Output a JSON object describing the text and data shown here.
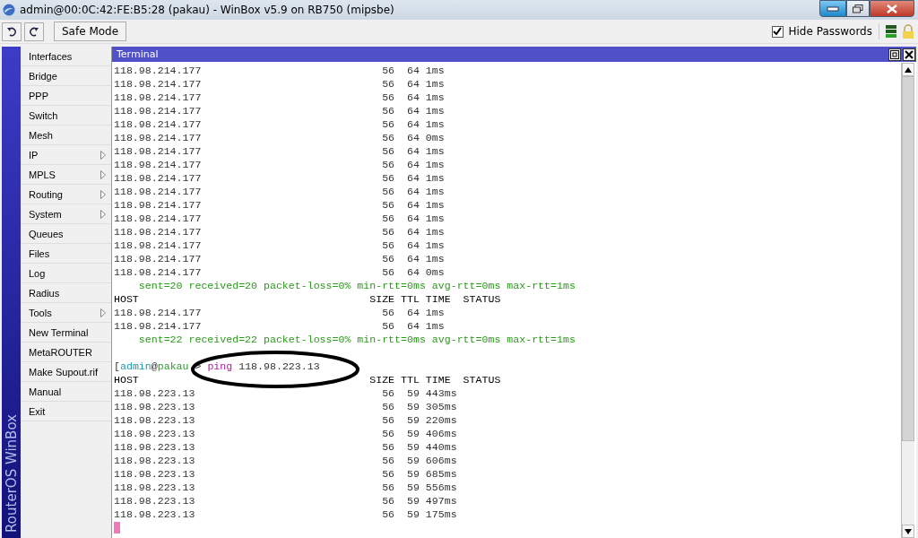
{
  "window": {
    "title": "admin@00:0C:42:FE:B5:28 (pakau) - WinBox v5.9 on RB750 (mipsbe)"
  },
  "toolbar": {
    "safe_mode": "Safe Mode",
    "hide_passwords": {
      "label": "Hide Passwords",
      "checked": true
    }
  },
  "sidebar": {
    "brand": "RouterOS WinBox",
    "items": [
      {
        "label": "Interfaces",
        "submenu": false
      },
      {
        "label": "Bridge",
        "submenu": false
      },
      {
        "label": "PPP",
        "submenu": false
      },
      {
        "label": "Switch",
        "submenu": false
      },
      {
        "label": "Mesh",
        "submenu": false
      },
      {
        "label": "IP",
        "submenu": true
      },
      {
        "label": "MPLS",
        "submenu": true
      },
      {
        "label": "Routing",
        "submenu": true
      },
      {
        "label": "System",
        "submenu": true
      },
      {
        "label": "Queues",
        "submenu": false
      },
      {
        "label": "Files",
        "submenu": false
      },
      {
        "label": "Log",
        "submenu": false
      },
      {
        "label": "Radius",
        "submenu": false
      },
      {
        "label": "Tools",
        "submenu": true
      },
      {
        "label": "New Terminal",
        "submenu": false
      },
      {
        "label": "MetaROUTER",
        "submenu": false
      },
      {
        "label": "Make Supout.rif",
        "submenu": false
      },
      {
        "label": "Manual",
        "submenu": false
      },
      {
        "label": "Exit",
        "submenu": false
      }
    ]
  },
  "terminal": {
    "title": "Terminal",
    "lines": [
      {
        "kind": "row",
        "host": "118.98.214.177",
        "size": "56",
        "ttl": "64",
        "time": "1ms"
      },
      {
        "kind": "row",
        "host": "118.98.214.177",
        "size": "56",
        "ttl": "64",
        "time": "1ms"
      },
      {
        "kind": "row",
        "host": "118.98.214.177",
        "size": "56",
        "ttl": "64",
        "time": "1ms"
      },
      {
        "kind": "row",
        "host": "118.98.214.177",
        "size": "56",
        "ttl": "64",
        "time": "1ms"
      },
      {
        "kind": "row",
        "host": "118.98.214.177",
        "size": "56",
        "ttl": "64",
        "time": "1ms"
      },
      {
        "kind": "row",
        "host": "118.98.214.177",
        "size": "56",
        "ttl": "64",
        "time": "0ms"
      },
      {
        "kind": "row",
        "host": "118.98.214.177",
        "size": "56",
        "ttl": "64",
        "time": "1ms"
      },
      {
        "kind": "row",
        "host": "118.98.214.177",
        "size": "56",
        "ttl": "64",
        "time": "1ms"
      },
      {
        "kind": "row",
        "host": "118.98.214.177",
        "size": "56",
        "ttl": "64",
        "time": "1ms"
      },
      {
        "kind": "row",
        "host": "118.98.214.177",
        "size": "56",
        "ttl": "64",
        "time": "1ms"
      },
      {
        "kind": "row",
        "host": "118.98.214.177",
        "size": "56",
        "ttl": "64",
        "time": "1ms"
      },
      {
        "kind": "row",
        "host": "118.98.214.177",
        "size": "56",
        "ttl": "64",
        "time": "1ms"
      },
      {
        "kind": "row",
        "host": "118.98.214.177",
        "size": "56",
        "ttl": "64",
        "time": "1ms"
      },
      {
        "kind": "row",
        "host": "118.98.214.177",
        "size": "56",
        "ttl": "64",
        "time": "1ms"
      },
      {
        "kind": "row",
        "host": "118.98.214.177",
        "size": "56",
        "ttl": "64",
        "time": "1ms"
      },
      {
        "kind": "row",
        "host": "118.98.214.177",
        "size": "56",
        "ttl": "64",
        "time": "0ms"
      },
      {
        "kind": "summary",
        "text": "sent=20 received=20 packet-loss=0% min-rtt=0ms avg-rtt=0ms max-rtt=1ms"
      },
      {
        "kind": "header",
        "host": "HOST",
        "size": "SIZE",
        "ttl": "TTL",
        "time": "TIME",
        "status": "STATUS"
      },
      {
        "kind": "row",
        "host": "118.98.214.177",
        "size": "56",
        "ttl": "64",
        "time": "1ms"
      },
      {
        "kind": "row",
        "host": "118.98.214.177",
        "size": "56",
        "ttl": "64",
        "time": "1ms"
      },
      {
        "kind": "summary",
        "text": "sent=22 received=22 packet-loss=0% min-rtt=0ms avg-rtt=0ms max-rtt=1ms"
      },
      {
        "kind": "blank"
      },
      {
        "kind": "prompt",
        "parts": [
          {
            "kind": "plain",
            "text": "["
          },
          {
            "kind": "user",
            "text": "admin"
          },
          {
            "kind": "plain",
            "text": "@"
          },
          {
            "kind": "host",
            "text": "pakau"
          },
          {
            "kind": "gap",
            "text": " > "
          },
          {
            "kind": "command",
            "text": "ping"
          },
          {
            "kind": "plain",
            "text": " 118.98.223.13"
          }
        ]
      },
      {
        "kind": "header",
        "host": "HOST",
        "size": "SIZE",
        "ttl": "TTL",
        "time": "TIME",
        "status": "STATUS"
      },
      {
        "kind": "row",
        "host": "118.98.223.13",
        "size": "56",
        "ttl": "59",
        "time": "443ms"
      },
      {
        "kind": "row",
        "host": "118.98.223.13",
        "size": "56",
        "ttl": "59",
        "time": "305ms"
      },
      {
        "kind": "row",
        "host": "118.98.223.13",
        "size": "56",
        "ttl": "59",
        "time": "220ms"
      },
      {
        "kind": "row",
        "host": "118.98.223.13",
        "size": "56",
        "ttl": "59",
        "time": "406ms"
      },
      {
        "kind": "row",
        "host": "118.98.223.13",
        "size": "56",
        "ttl": "59",
        "time": "440ms"
      },
      {
        "kind": "row",
        "host": "118.98.223.13",
        "size": "56",
        "ttl": "59",
        "time": "606ms"
      },
      {
        "kind": "row",
        "host": "118.98.223.13",
        "size": "56",
        "ttl": "59",
        "time": "685ms"
      },
      {
        "kind": "row",
        "host": "118.98.223.13",
        "size": "56",
        "ttl": "59",
        "time": "556ms"
      },
      {
        "kind": "row",
        "host": "118.98.223.13",
        "size": "56",
        "ttl": "59",
        "time": "497ms"
      },
      {
        "kind": "row",
        "host": "118.98.223.13",
        "size": "56",
        "ttl": "59",
        "time": "175ms"
      },
      {
        "kind": "cursor"
      }
    ]
  }
}
